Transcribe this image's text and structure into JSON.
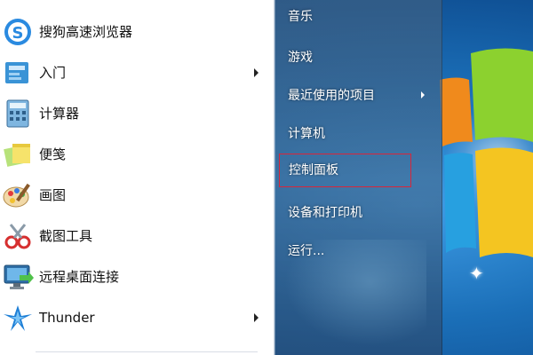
{
  "start_menu": {
    "left_items": [
      {
        "label": "搜狗高速浏览器",
        "icon": "sogou-browser-icon",
        "has_submenu": false
      },
      {
        "label": "入门",
        "icon": "getting-started-icon",
        "has_submenu": true
      },
      {
        "label": "计算器",
        "icon": "calculator-icon",
        "has_submenu": false
      },
      {
        "label": "便笺",
        "icon": "sticky-notes-icon",
        "has_submenu": false
      },
      {
        "label": "画图",
        "icon": "paint-icon",
        "has_submenu": false
      },
      {
        "label": "截图工具",
        "icon": "snipping-tool-icon",
        "has_submenu": false
      },
      {
        "label": "远程桌面连接",
        "icon": "remote-desktop-icon",
        "has_submenu": false
      },
      {
        "label": "Thunder",
        "icon": "thunder-icon",
        "has_submenu": true
      }
    ],
    "right_items": [
      {
        "label": "音乐",
        "has_submenu": false
      },
      {
        "label": "游戏",
        "has_submenu": false
      },
      {
        "label": "最近使用的项目",
        "has_submenu": true
      },
      {
        "label": "计算机",
        "has_submenu": false
      },
      {
        "label": "控制面板",
        "has_submenu": false,
        "highlighted": true
      },
      {
        "label": "设备和打印机",
        "has_submenu": false
      },
      {
        "label": "运行...",
        "has_submenu": false
      }
    ]
  },
  "colors": {
    "highlight_border": "#d9263a",
    "left_panel_bg": "#ffffff",
    "right_text": "#ffffff"
  }
}
